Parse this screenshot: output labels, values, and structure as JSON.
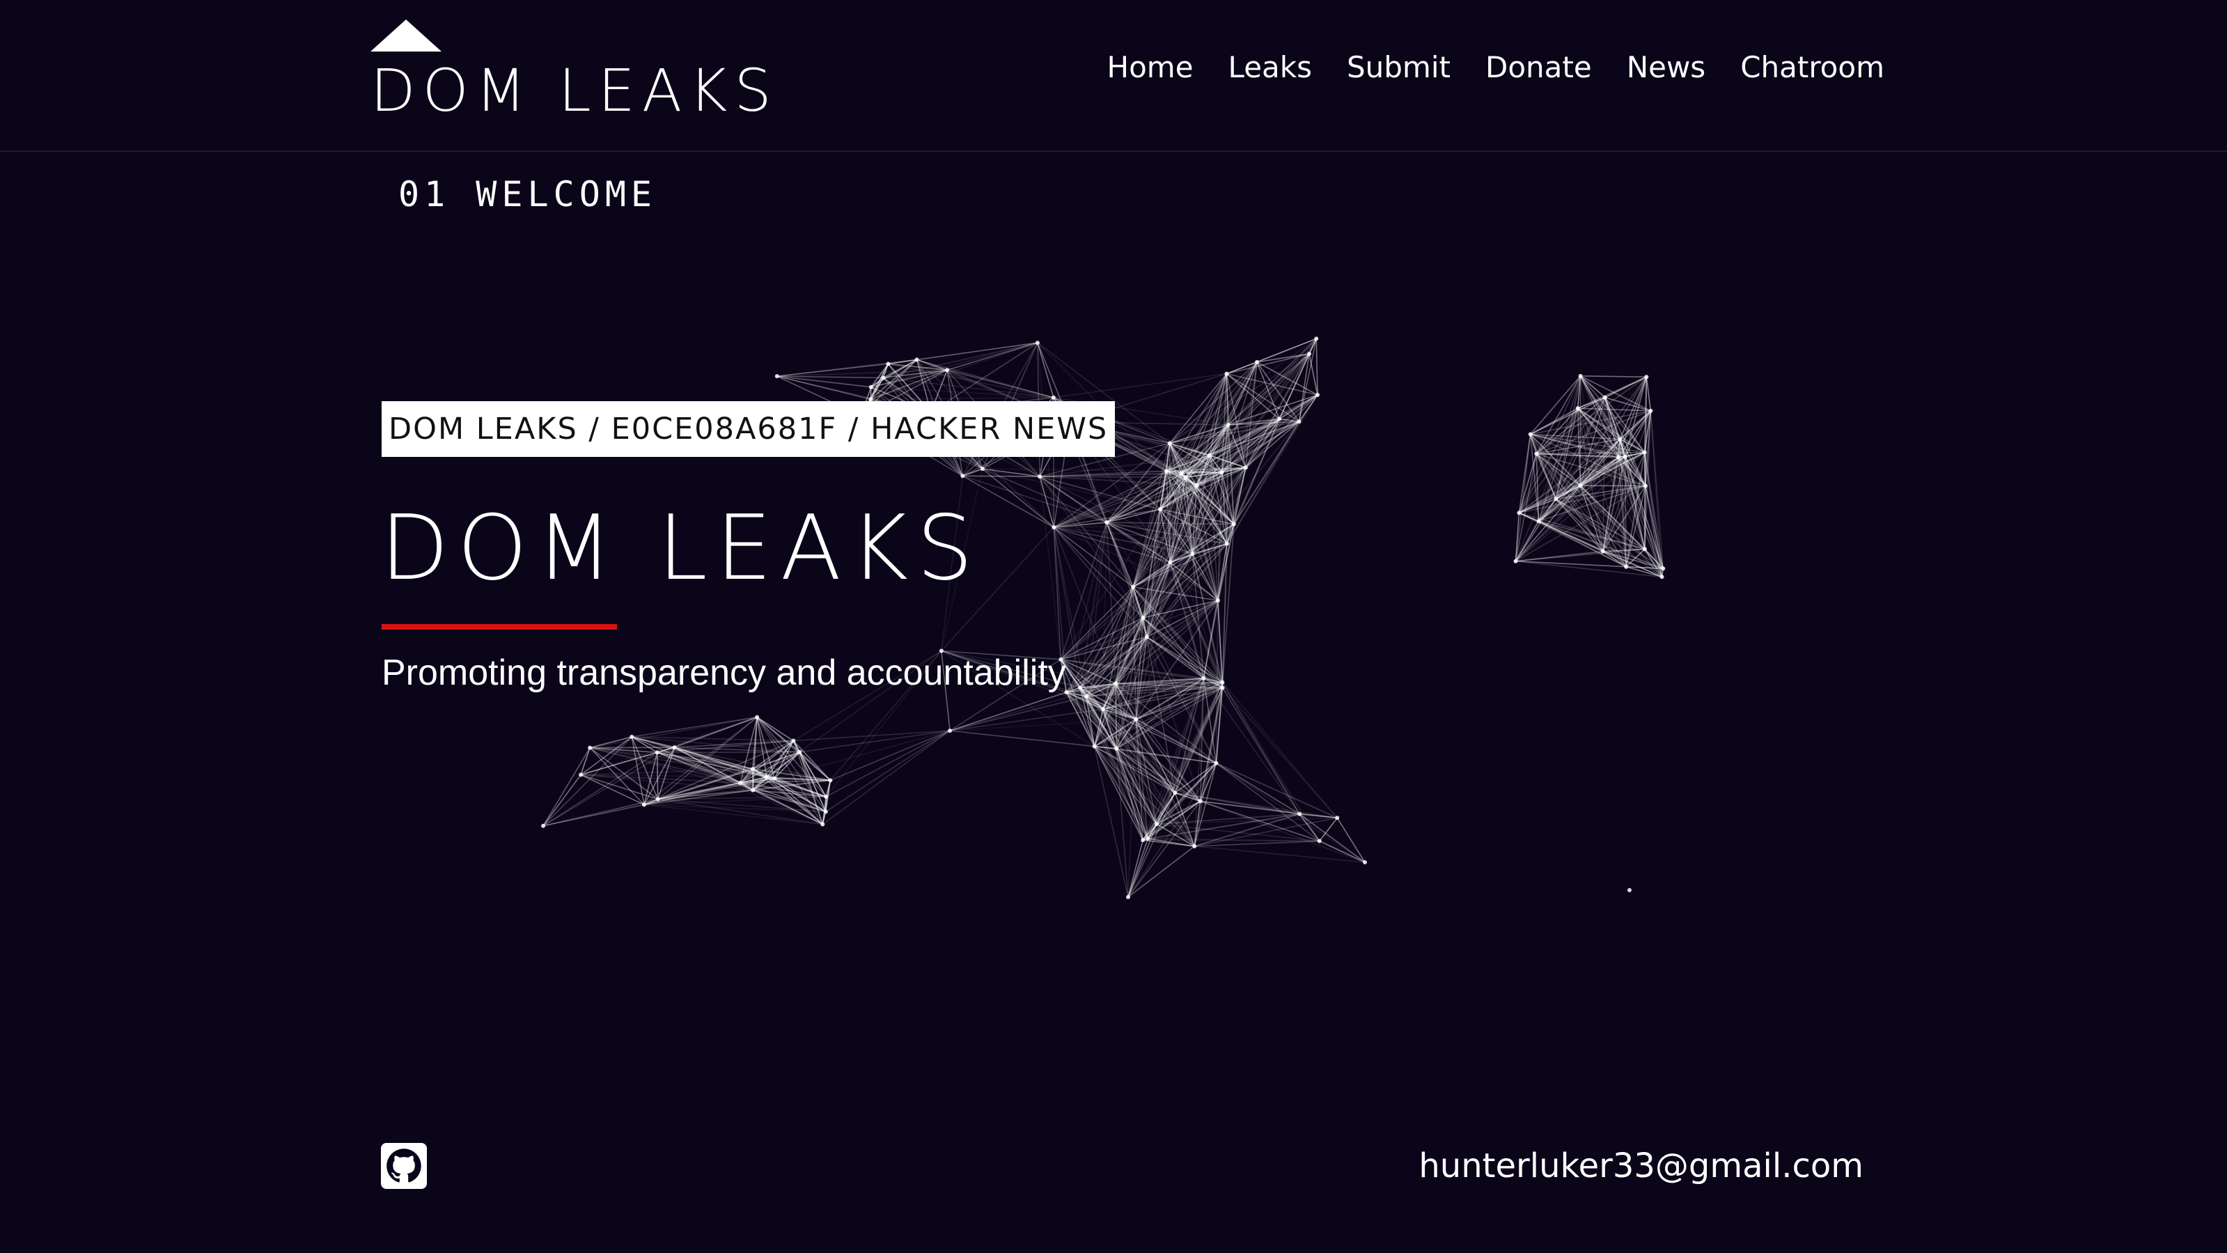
{
  "header": {
    "logo_text": "DOM LEAKS",
    "nav": [
      {
        "label": "Home"
      },
      {
        "label": "Leaks"
      },
      {
        "label": "Submit"
      },
      {
        "label": "Donate"
      },
      {
        "label": "News"
      },
      {
        "label": "Chatroom"
      }
    ]
  },
  "section": {
    "label": "01 WELCOME"
  },
  "hero": {
    "tag": "DOM LEAKS / E0CE08A681F / HACKER NEWS",
    "title": "DOM LEAKS",
    "subtitle": "Promoting transparency and accountability"
  },
  "footer": {
    "github_icon": "github-icon",
    "email": "hunterluker33@gmail.com"
  },
  "colors": {
    "background": "#0b0519",
    "accent": "#dc1212",
    "text": "#ffffff"
  }
}
